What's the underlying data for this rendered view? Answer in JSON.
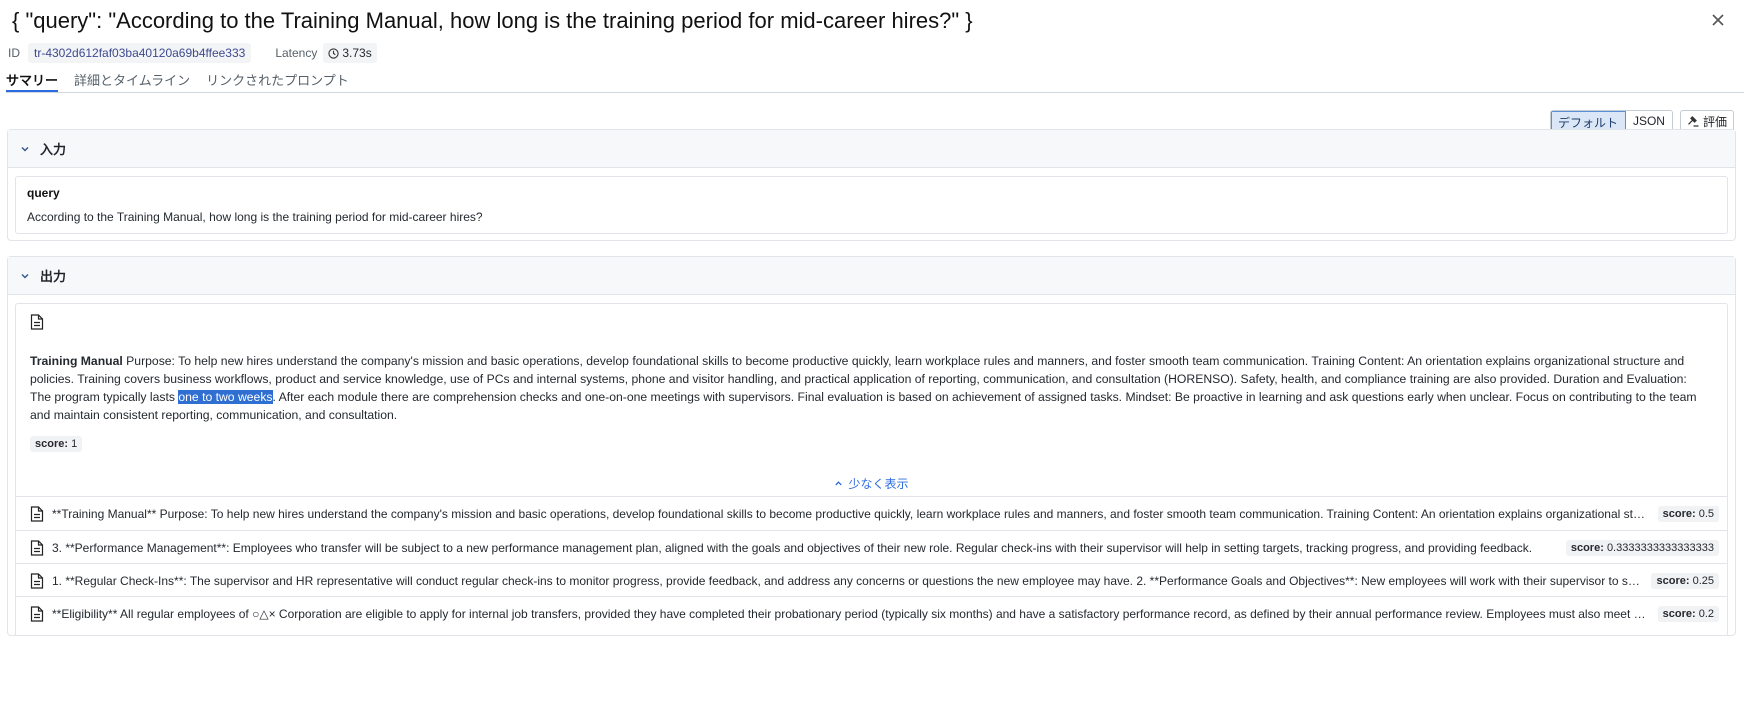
{
  "header": {
    "title": "{ \"query\": \"According to the Training Manual, how long is the training period for mid-career hires?\" }",
    "id_label": "ID",
    "id_value": "tr-4302d612faf03ba40120a69b4ffee333",
    "latency_label": "Latency",
    "latency_value": "3.73s"
  },
  "tabs": [
    {
      "label": "サマリー",
      "active": true
    },
    {
      "label": "詳細とタイムライン",
      "active": false
    },
    {
      "label": "リンクされたプロンプト",
      "active": false
    }
  ],
  "view": {
    "default_label": "デフォルト",
    "json_label": "JSON",
    "eval_label": "評価"
  },
  "input": {
    "section_title": "入力",
    "key": "query",
    "value": "According to the Training Manual, how long is the training period for mid-career hires?"
  },
  "output": {
    "section_title": "出力",
    "doc_title": "Training Manual",
    "doc_before": " Purpose: To help new hires understand the company's mission and basic operations, develop foundational skills to become productive quickly, learn workplace rules and manners, and foster smooth team communication. Training Content: An orientation explains organizational structure and policies. Training covers business workflows, product and service knowledge, use of PCs and internal systems, phone and visitor handling, and practical application of reporting, communication, and consultation (HORENSO). Safety, health, and compliance training are also provided. Duration and Evaluation: The program typically lasts ",
    "doc_highlight": "one to two weeks",
    "doc_after": ". After each module there are comprehension checks and one-on-one meetings with supervisors. Final evaluation is based on achievement of assigned tasks. Mindset: Be proactive in learning and ask questions early when unclear. Focus on contributing to the team and maintain consistent reporting, communication, and consultation.",
    "score_label": "score:",
    "score_value": "1",
    "show_less": "少なく表示",
    "results": [
      {
        "text": "**Training Manual** Purpose: To help new hires understand the company's mission and basic operations, develop foundational skills to become productive quickly, learn workplace rules and manners, and foster smooth team communication. Training Content: An orientation explains organizational structure and policies.",
        "score_label": "score:",
        "score": "0.5"
      },
      {
        "text": "3. **Performance Management**: Employees who transfer will be subject to a new performance management plan, aligned with the goals and objectives of their new role. Regular check-ins with their supervisor will help in setting targets, tracking progress, and providing feedback.",
        "score_label": "score:",
        "score": "0.3333333333333333"
      },
      {
        "text": "1. **Regular Check-Ins**: The supervisor and HR representative will conduct regular check-ins to monitor progress, provide feedback, and address any concerns or questions the new employee may have. 2. **Performance Goals and Objectives**: New employees will work with their supervisor to set goals.",
        "score_label": "score:",
        "score": "0.25"
      },
      {
        "text": "**Eligibility** All regular employees of ○△× Corporation are eligible to apply for internal job transfers, provided they have completed their probationary period (typically six months) and have a satisfactory performance record, as defined by their annual performance review. Employees must also meet the requirements.",
        "score_label": "score:",
        "score": "0.2"
      }
    ]
  }
}
